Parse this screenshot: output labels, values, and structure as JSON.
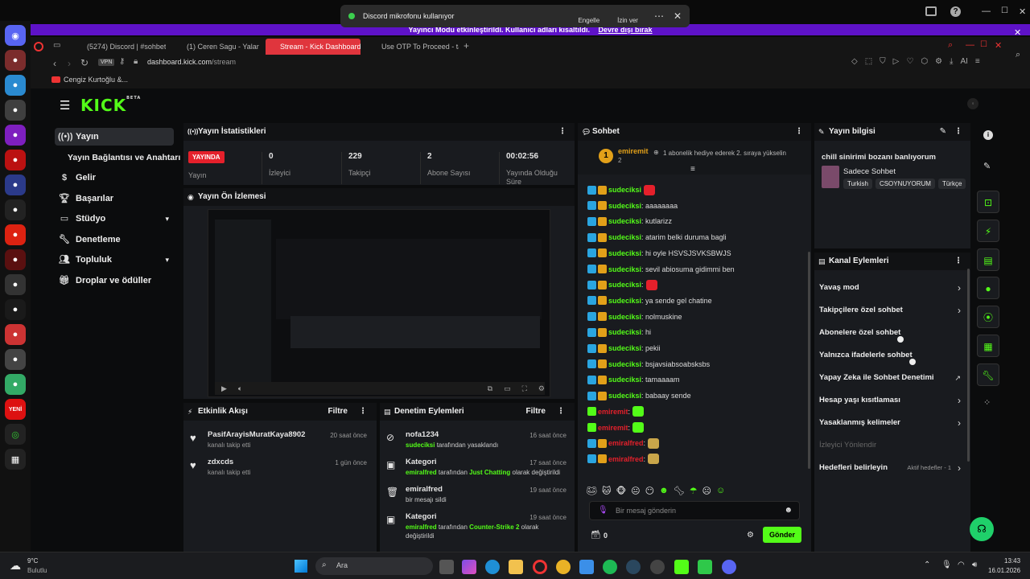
{
  "notification": {
    "text": "Discord mikrofonu kullanıyor",
    "block": "Engelle",
    "allow": "İzin ver"
  },
  "banner": {
    "text": "Yayıncı Modu etkinleştirildi. Kullanıcı adları kısaltıldı.",
    "disable": "Devre dışı bırak"
  },
  "tabs": [
    {
      "label": "(5274) Discord | #sohbet"
    },
    {
      "label": "(1) Ceren Sagu - Yalan"
    },
    {
      "label": "Stream - Kick Dashboard"
    },
    {
      "label": "Use OTP To Proceed - take"
    }
  ],
  "url": {
    "host": "dashboard.kick.com",
    "path": "/stream"
  },
  "bookmark": "Cengiz Kurtoğlu &...",
  "rail_badge": "YENİ",
  "sidebar": {
    "logo": "KICK",
    "logo_tag": "BETA",
    "items": [
      {
        "label": "Yayın"
      },
      {
        "label": "Yayın Bağlantısı ve Anahtarı"
      },
      {
        "label": "Gelir"
      },
      {
        "label": "Başarılar"
      },
      {
        "label": "Stüdyo"
      },
      {
        "label": "Denetleme"
      },
      {
        "label": "Topluluk"
      },
      {
        "label": "Droplar ve ödüller"
      }
    ]
  },
  "stats": {
    "title": "Yayın İstatistikleri",
    "live_badge": "YAYINDA",
    "live_label": "Yayın",
    "viewers_value": "0",
    "viewers_label": "İzleyici",
    "followers_value": "229",
    "followers_label": "Takipçi",
    "subs_value": "2",
    "subs_label": "Abone Sayısı",
    "duration_value": "00:02:56",
    "duration_label": "Yayında Olduğu Süre"
  },
  "preview": {
    "title": "Yayın Ön İzlemesi"
  },
  "activity": {
    "title": "Etkinlik Akışı",
    "filter": "Filtre",
    "items": [
      {
        "name": "PasifArayisMuratKaya8902",
        "desc": "kanalı takip etti",
        "time": "20 saat önce"
      },
      {
        "name": "zdxcds",
        "desc": "kanalı takip etti",
        "time": "1 gün önce"
      }
    ]
  },
  "moderation": {
    "title": "Denetim Eylemleri",
    "filter": "Filtre",
    "items": [
      {
        "name": "nofa1234",
        "line1a": "sudeciksi",
        "line1b": " tarafından yasaklandı",
        "line1c": "",
        "line1d": "",
        "line2": "",
        "time": "16 saat önce"
      },
      {
        "name": "Kategori",
        "line1a": "emiralfred",
        "line1b": " tarafından ",
        "line1c": "Just Chatting",
        "line1d": " olarak değiştirildi",
        "line2": "",
        "time": "17 saat önce"
      },
      {
        "name": "emiralfred",
        "line1a": "",
        "line1b": "bir mesajı sildi",
        "line1c": "",
        "line1d": "",
        "line2": "",
        "time": "19 saat önce"
      },
      {
        "name": "Kategori",
        "line1a": "emiralfred",
        "line1b": " tarafından ",
        "line1c": "Counter-Strike 2",
        "line1d": " olarak",
        "line2": "değiştirildi",
        "time": "19 saat önce"
      }
    ]
  },
  "chat": {
    "title": "Sohbet",
    "pinned_user": "emiremit",
    "pinned_count": "2",
    "pinned_text": "1 abonelik hediye ederek 2. sıraya yükselin",
    "messages": [
      {
        "user": "sudeciksi",
        "text": ""
      },
      {
        "user": "sudeciksi",
        "text": ": aaaaaaaa"
      },
      {
        "user": "sudeciksi",
        "text": ": kutlarizz"
      },
      {
        "user": "sudeciksi",
        "text": ": atarim belki duruma bagli"
      },
      {
        "user": "sudeciksi",
        "text": ": hi oyle HSVSJSVKSBWJS"
      },
      {
        "user": "sudeciksi",
        "text": ": sevil abiosuma gidimmi ben"
      },
      {
        "user": "sudeciksi",
        "text": ":"
      },
      {
        "user": "sudeciksi",
        "text": ": ya sende gel chatine"
      },
      {
        "user": "sudeciksi",
        "text": ": nolmuskine"
      },
      {
        "user": "sudeciksi",
        "text": ": hi"
      },
      {
        "user": "sudeciksi",
        "text": ": pekii"
      },
      {
        "user": "sudeciksi",
        "text": ": bsjavsiabsoabsksbs"
      },
      {
        "user": "sudeciksi",
        "text": ": tamaaaam"
      },
      {
        "user": "sudeciksi",
        "text": ": babaay sende"
      },
      {
        "user": "emiremit",
        "text": ":"
      },
      {
        "user": "emiremit",
        "text": ":"
      },
      {
        "user": "emiralfred",
        "text": ":"
      },
      {
        "user": "emiralfred",
        "text": ":"
      }
    ],
    "placeholder": "Bir mesaj gönderin",
    "points": "0",
    "send": "Gönder"
  },
  "info": {
    "title": "Yayın bilgisi",
    "stream_title": "chill sinirimi bozanı banlıyorum",
    "category": "Sadece Sohbet",
    "tags": [
      "Turkish",
      "CSOYNUYORUM",
      "Türkçe"
    ]
  },
  "actions": {
    "title": "Kanal Eylemleri",
    "items": [
      {
        "label": "Yavaş mod"
      },
      {
        "label": "Takipçilere özel sohbet"
      },
      {
        "label": "Abonelere özel sohbet"
      },
      {
        "label": "Yalnızca ifadelerle sohbet"
      },
      {
        "label": "Yapay Zeka ile Sohbet Denetimi"
      },
      {
        "label": "Hesap yaşı kısıtlaması"
      },
      {
        "label": "Yasaklanmış kelimeler"
      },
      {
        "label": "İzleyici Yönlendir"
      },
      {
        "label": "Hedefleri belirleyin"
      }
    ],
    "goals_value": "Aktif hedefler - 1"
  },
  "taskbar": {
    "weather_temp": "9°C",
    "weather_desc": "Bulutlu",
    "search": "Ara",
    "time": "13:43",
    "date": "16.01.2026"
  },
  "colors": {
    "kick_green": "#53fc18",
    "live_red": "#e5202b",
    "banner_purple": "#5e12c8"
  }
}
